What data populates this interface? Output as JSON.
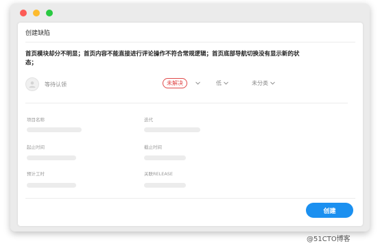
{
  "dialog": {
    "title": "创建缺陷"
  },
  "defect": {
    "description": "首页模块却分不明显；首页内容不能直接进行评论操作不符合常规逻辑；首页底部导航切换没有显示新的状态；"
  },
  "assignee": {
    "placeholder": "等待认领",
    "icon": "user-avatar-icon"
  },
  "status": {
    "label": "未解决",
    "color": "#e04848"
  },
  "priority": {
    "label": "低"
  },
  "category": {
    "label": "未分类"
  },
  "fields": {
    "project": "项目名称",
    "iteration": "迭代",
    "start_time": "起止时间",
    "end_time": "截止时间",
    "estimate": "预计工时",
    "release": "关联RELEASE"
  },
  "actions": {
    "create": "创建",
    "accent": "#1b90f0"
  },
  "watermark": "@51CTO博客"
}
